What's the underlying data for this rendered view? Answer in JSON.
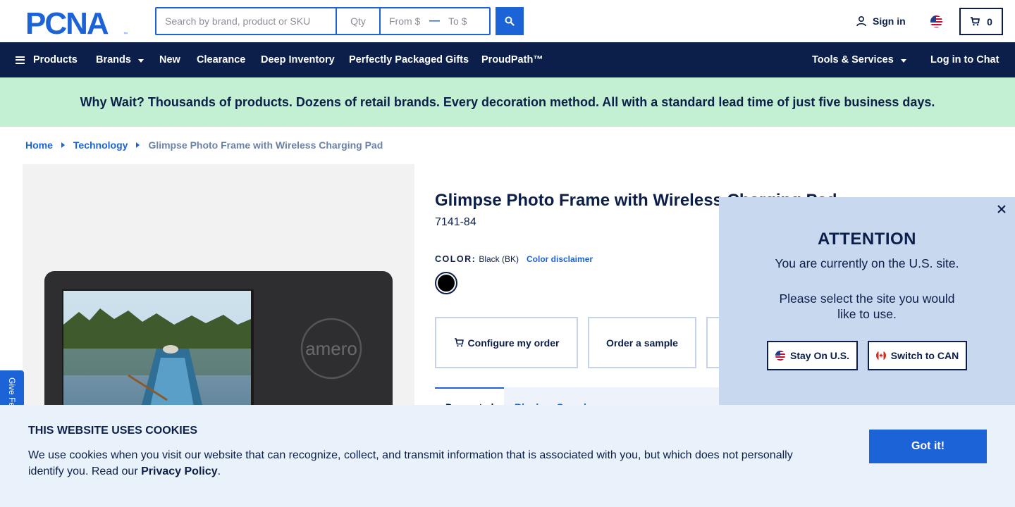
{
  "header": {
    "logo_text": "PCNA",
    "search_placeholder": "Search by brand, product or SKU",
    "qty_placeholder": "Qty",
    "from_placeholder": "From $",
    "to_placeholder": "To $",
    "sign_in_label": "Sign in",
    "cart_count": "0"
  },
  "nav": {
    "products": "Products",
    "brands": "Brands",
    "new": "New",
    "clearance": "Clearance",
    "deep_inventory": "Deep Inventory",
    "gifts": "Perfectly Packaged Gifts",
    "proudpath": "ProudPath™",
    "tools": "Tools & Services",
    "chat": "Log in to Chat"
  },
  "banner": {
    "text": "Why Wait? Thousands of products. Dozens of retail brands. Every decoration method. All with a standard lead time of just five business days."
  },
  "breadcrumb": {
    "home": "Home",
    "category": "Technology",
    "current": "Glimpse Photo Frame with Wireless Charging Pad"
  },
  "product": {
    "title": "Glimpse Photo Frame with Wireless Charging Pad",
    "sku": "7141-84",
    "color_label": "COLOR:",
    "color_value": "Black (BK)",
    "color_disclaimer": "Color disclaimer",
    "swatch_color": "#000000",
    "image_brand": "amero",
    "configure_label": "Configure my order",
    "sample_label": "Order a sample",
    "tab_1": "Decorated",
    "tab_2": "Blank or Sample"
  },
  "feedback": {
    "label": "Give Feedback"
  },
  "popup": {
    "title": "ATTENTION",
    "line1": "You are currently on the U.S. site.",
    "line2": "Please select the site you would like to use.",
    "stay_label": "Stay On U.S.",
    "switch_label": "Switch to CAN"
  },
  "cookie": {
    "title": "THIS WEBSITE USES COOKIES",
    "text": "We use cookies when you visit our website that can recognize, collect, and transmit information that is associated with you, but which does not personally identify you. Read our",
    "link": "Privacy Policy",
    "period": ".",
    "button": "Got it!"
  },
  "colors": {
    "navy": "#0b1f4a",
    "blue": "#1d63d8",
    "banner_green": "#c3f0d2",
    "popup_bg": "#c7d8ef",
    "cookie_bg": "#e9f1fb"
  }
}
